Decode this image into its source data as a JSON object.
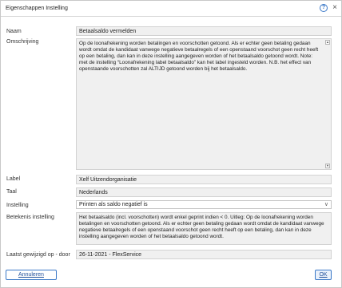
{
  "window": {
    "title": "Eigenschappen Instelling",
    "help_glyph": "?",
    "close_glyph": "×"
  },
  "fields": {
    "naam": {
      "label": "Naam",
      "value": "Betaalsaldo vermelden"
    },
    "omschrijving": {
      "label": "Omschrijving",
      "value": "Op de loonafrekening worden betalingen en voorschotten getoond. Als er echter geen betaling gedaan wordt omdat de kandidaat vanwege negatieve betaalregels of een openstaand voorschot geen recht heeft op een betaling, dan kan in deze instelling aangegeven worden of het betaalsaldo getoond wordt. Note: met de instelling “Loonafrekening label betaalsaldo” kan het label ingesteld worden. N.B. het effect van openstaande voorschotten zal ALTIJD getoond worden bij het betaalsaldo."
    },
    "label": {
      "label": "Label",
      "value": "Xelf Uitzendorganisatie"
    },
    "taal": {
      "label": "Taal",
      "value": "Nederlands"
    },
    "instelling": {
      "label": "Instelling",
      "value": "Printen als saldo negatief is"
    },
    "betekenis": {
      "label": "Betekenis instelling",
      "value": "Het betaalsaldo (incl. voorschotten) wordt enkel geprint indien < 0. Uitleg: Op de loonafrekening worden betalingen en voorschotten getoond. Als er echter geen betaling gedaan wordt omdat de kandidaat vanwege negatieve betaalregels of een openstaand voorschot geen recht heeft op een betaling, dan kan in deze instelling aangegeven worden of het betaalsaldo getoond wordt."
    },
    "gewijzigd": {
      "label": "Laatst gewijzigd op - door",
      "value": "26-11-2021 - FlexService"
    }
  },
  "buttons": {
    "cancel": "Annuleren",
    "ok": "OK"
  },
  "icons": {
    "help": "help-icon",
    "close": "close-icon",
    "dropdown": "chevron-down-icon"
  },
  "colors": {
    "accent": "#3b79c8",
    "field_bg": "#f0f0f0"
  }
}
